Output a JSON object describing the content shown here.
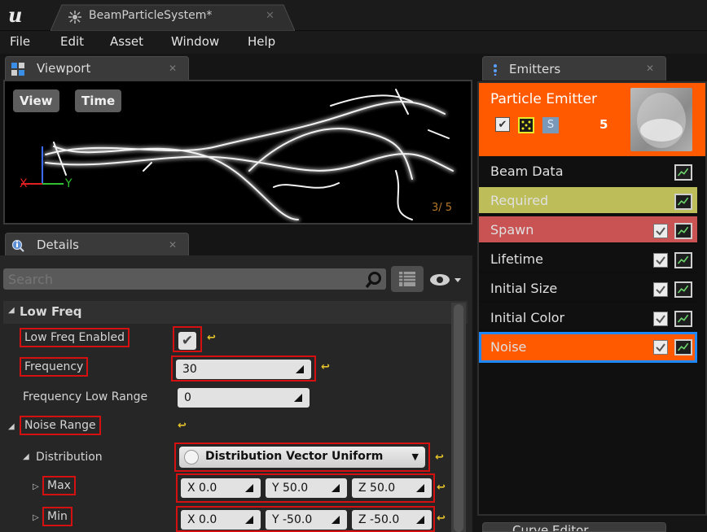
{
  "window": {
    "document_tab": "BeamParticleSystem*"
  },
  "menu": {
    "items": [
      "File",
      "Edit",
      "Asset",
      "Window",
      "Help"
    ]
  },
  "viewport": {
    "tab_label": "Viewport",
    "view_button": "View",
    "time_button": "Time",
    "counter": "3/ 5",
    "axis_x": "X",
    "axis_y": "Y"
  },
  "details": {
    "tab_label": "Details",
    "search_placeholder": "Search",
    "group": "Low Freq",
    "properties": {
      "low_freq_enabled": {
        "label": "Low Freq Enabled",
        "checked": true
      },
      "frequency": {
        "label": "Frequency",
        "value": "30"
      },
      "frequency_low_range": {
        "label": "Frequency Low Range",
        "value": "0"
      },
      "noise_range": {
        "label": "Noise Range"
      },
      "distribution": {
        "label": "Distribution",
        "value": "Distribution Vector Uniform"
      },
      "max": {
        "label": "Max",
        "x": "X  0.0",
        "y": "Y  50.0",
        "z": "Z  50.0"
      },
      "min": {
        "label": "Min",
        "x": "X  0.0",
        "y": "Y  -50.0",
        "z": "Z  -50.0"
      }
    }
  },
  "emitters": {
    "tab_label": "Emitters",
    "emitter_name": "Particle Emitter",
    "emitter_count": "5",
    "modules": [
      {
        "label": "Beam Data",
        "checkbox": false,
        "color": "#151515"
      },
      {
        "label": "Required",
        "checkbox": false,
        "color": "#bdbd5a"
      },
      {
        "label": "Spawn",
        "checkbox": true,
        "color": "#c95252"
      },
      {
        "label": "Lifetime",
        "checkbox": true,
        "color": "#151515"
      },
      {
        "label": "Initial Size",
        "checkbox": true,
        "color": "#151515"
      },
      {
        "label": "Initial Color",
        "checkbox": true,
        "color": "#151515"
      },
      {
        "label": "Noise",
        "checkbox": true,
        "color": "#ff5a00",
        "selected": true
      }
    ]
  },
  "curve_editor": {
    "tab_label": "Curve Editor"
  },
  "colors": {
    "accent_orange": "#ff5a00",
    "highlight_red": "#d41010",
    "selection_blue": "#1e88ff"
  }
}
